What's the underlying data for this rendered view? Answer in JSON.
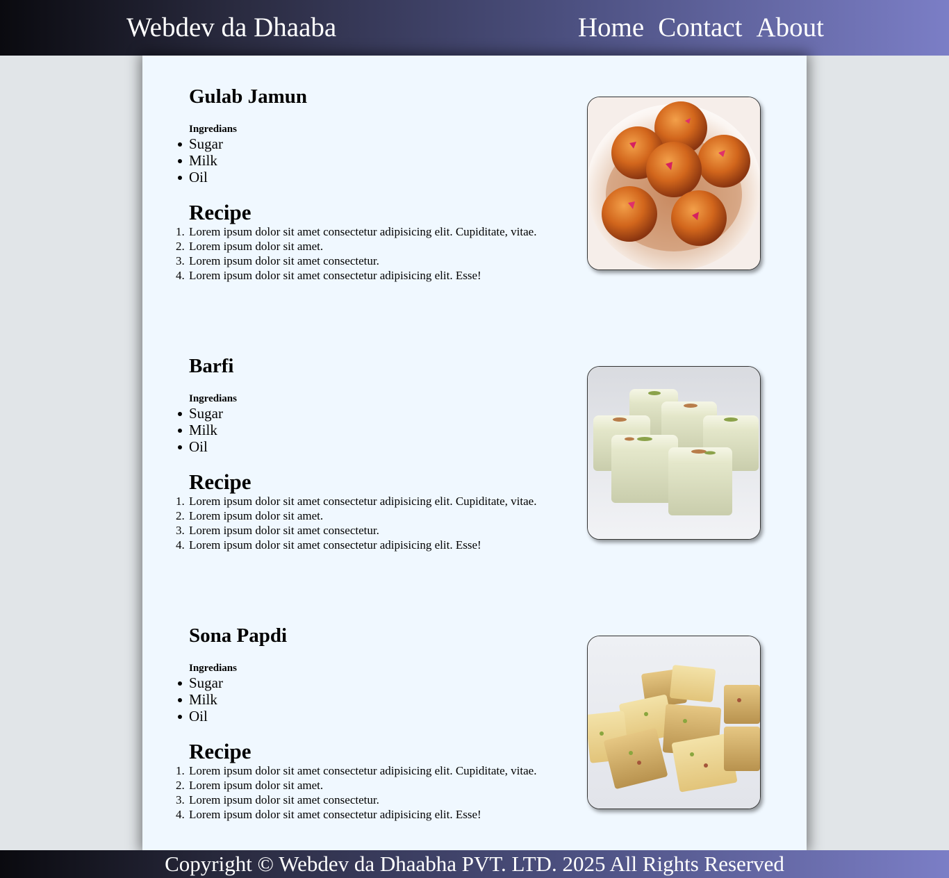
{
  "header": {
    "brand": "Webdev da Dhaaba",
    "nav": [
      "Home",
      "Contact",
      "About"
    ]
  },
  "dishes": [
    {
      "title": "Gulab Jamun",
      "ingredients_label": "Ingredians",
      "ingredients": [
        "Sugar",
        "Milk",
        "Oil"
      ],
      "recipe_title": "Recipe",
      "recipe_steps": [
        "Lorem ipsum dolor sit amet consectetur adipisicing elit. Cupiditate, vitae.",
        "Lorem ipsum dolor sit amet.",
        "Lorem ipsum dolor sit amet consectetur.",
        "Lorem ipsum dolor sit amet consectetur adipisicing elit. Esse!"
      ]
    },
    {
      "title": "Barfi",
      "ingredients_label": "Ingredians",
      "ingredients": [
        "Sugar",
        "Milk",
        "Oil"
      ],
      "recipe_title": "Recipe",
      "recipe_steps": [
        "Lorem ipsum dolor sit amet consectetur adipisicing elit. Cupiditate, vitae.",
        "Lorem ipsum dolor sit amet.",
        "Lorem ipsum dolor sit amet consectetur.",
        "Lorem ipsum dolor sit amet consectetur adipisicing elit. Esse!"
      ]
    },
    {
      "title": "Sona Papdi",
      "ingredients_label": "Ingredians",
      "ingredients": [
        "Sugar",
        "Milk",
        "Oil"
      ],
      "recipe_title": "Recipe",
      "recipe_steps": [
        "Lorem ipsum dolor sit amet consectetur adipisicing elit. Cupiditate, vitae.",
        "Lorem ipsum dolor sit amet.",
        "Lorem ipsum dolor sit amet consectetur.",
        "Lorem ipsum dolor sit amet consectetur adipisicing elit. Esse!"
      ]
    }
  ],
  "footer": {
    "copyright": "Copyright © Webdev da Dhaabha PVT. LTD. 2025 All Rights Reserved"
  },
  "colors": {
    "page_background": "#e1e5e8",
    "content_background": "#f0f8ff",
    "header_gradient_start": "#0a0a0f",
    "header_gradient_end": "#7b7ec6"
  }
}
